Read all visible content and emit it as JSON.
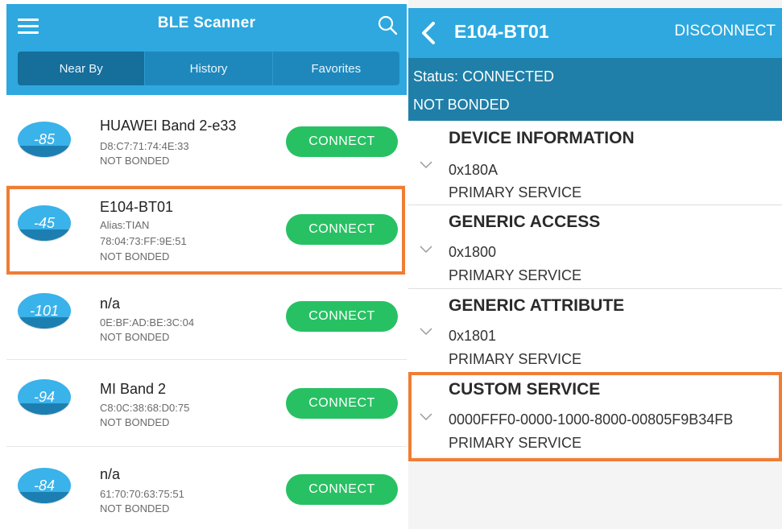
{
  "scanner": {
    "app_title": "BLE Scanner",
    "tabs": [
      {
        "label": "Near By"
      },
      {
        "label": "History"
      },
      {
        "label": "Favorites"
      }
    ],
    "connect_label": "CONNECT",
    "devices": [
      {
        "rssi": "-85",
        "name": "HUAWEI Band 2-e33",
        "line1": "D8:C7:71:74:4E:33",
        "line2": "NOT BONDED",
        "line3": ""
      },
      {
        "rssi": "-45",
        "name": "E104-BT01",
        "line1": "Alias:TIAN",
        "line2": "78:04:73:FF:9E:51",
        "line3": "NOT BONDED"
      },
      {
        "rssi": "-101",
        "name": "n/a",
        "line1": "0E:BF:AD:BE:3C:04",
        "line2": "NOT BONDED",
        "line3": ""
      },
      {
        "rssi": "-94",
        "name": "MI Band 2",
        "line1": "C8:0C:38:68:D0:75",
        "line2": "NOT BONDED",
        "line3": ""
      },
      {
        "rssi": "-84",
        "name": "n/a",
        "line1": "61:70:70:63:75:51",
        "line2": "NOT BONDED",
        "line3": ""
      }
    ]
  },
  "detail": {
    "device_title": "E104-BT01",
    "disconnect_label": "DISCONNECT",
    "status": "Status: CONNECTED",
    "bond": "NOT BONDED",
    "services": [
      {
        "name": "DEVICE INFORMATION",
        "uuid": "0x180A",
        "type": "PRIMARY SERVICE"
      },
      {
        "name": "GENERIC ACCESS",
        "uuid": "0x1800",
        "type": "PRIMARY SERVICE"
      },
      {
        "name": "GENERIC ATTRIBUTE",
        "uuid": "0x1801",
        "type": "PRIMARY SERVICE"
      },
      {
        "name": "CUSTOM SERVICE",
        "uuid": "0000FFF0-0000-1000-8000-00805F9B34FB",
        "type": "PRIMARY SERVICE"
      }
    ]
  },
  "colors": {
    "primary": "#2ea8df",
    "status_bar": "#1f7fa8",
    "connect_green": "#27c163",
    "highlight": "#f07d34"
  },
  "icons": {
    "menu": "hamburger-menu-icon",
    "search": "search-icon",
    "back": "back-chevron-icon",
    "expand": "chevron-down-icon"
  }
}
